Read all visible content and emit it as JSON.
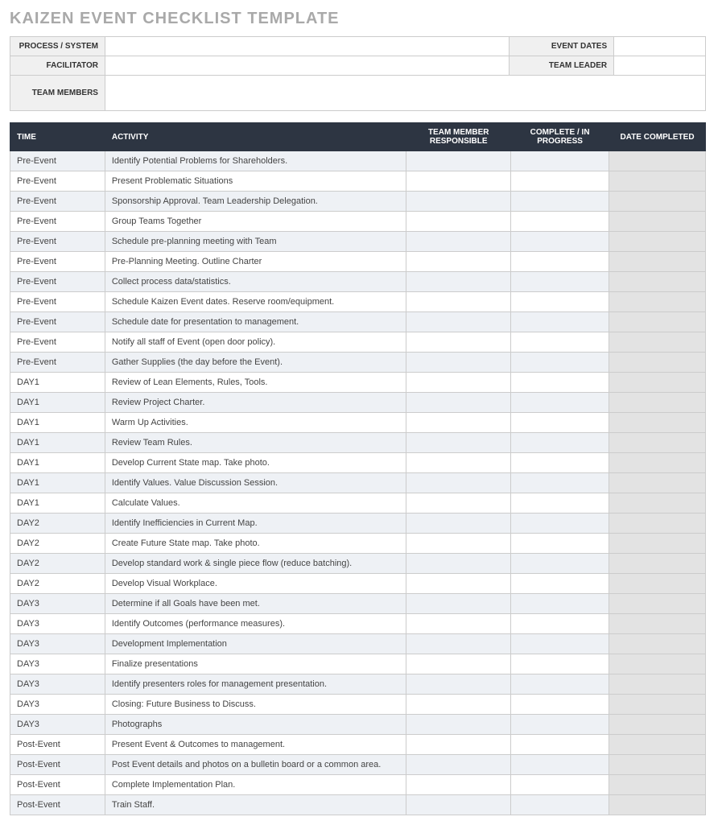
{
  "title": "KAIZEN EVENT CHECKLIST TEMPLATE",
  "info_labels": {
    "process_system": "PROCESS / SYSTEM",
    "event_dates": "EVENT DATES",
    "facilitator": "FACILITATOR",
    "team_leader": "TEAM LEADER",
    "team_members": "TEAM MEMBERS"
  },
  "info_values": {
    "process_system": "",
    "event_dates": "",
    "facilitator": "",
    "team_leader": "",
    "team_members": ""
  },
  "columns": {
    "time": "TIME",
    "activity": "ACTIVITY",
    "team_member": "TEAM MEMBER RESPONSIBLE",
    "complete": "COMPLETE / IN PROGRESS",
    "date_completed": "DATE COMPLETED"
  },
  "rows": [
    {
      "time": "Pre-Event",
      "activity": "Identify Potential Problems for Shareholders.",
      "tm": "",
      "comp": "",
      "date": ""
    },
    {
      "time": "Pre-Event",
      "activity": "Present Problematic Situations",
      "tm": "",
      "comp": "",
      "date": ""
    },
    {
      "time": "Pre-Event",
      "activity": "Sponsorship Approval. Team Leadership Delegation.",
      "tm": "",
      "comp": "",
      "date": ""
    },
    {
      "time": "Pre-Event",
      "activity": "Group Teams Together",
      "tm": "",
      "comp": "",
      "date": ""
    },
    {
      "time": "Pre-Event",
      "activity": "Schedule pre-planning meeting with Team",
      "tm": "",
      "comp": "",
      "date": ""
    },
    {
      "time": "Pre-Event",
      "activity": "Pre-Planning Meeting. Outline Charter",
      "tm": "",
      "comp": "",
      "date": ""
    },
    {
      "time": "Pre-Event",
      "activity": "Collect process data/statistics.",
      "tm": "",
      "comp": "",
      "date": ""
    },
    {
      "time": "Pre-Event",
      "activity": "Schedule Kaizen Event dates. Reserve room/equipment.",
      "tm": "",
      "comp": "",
      "date": ""
    },
    {
      "time": "Pre-Event",
      "activity": "Schedule date for presentation to management.",
      "tm": "",
      "comp": "",
      "date": ""
    },
    {
      "time": "Pre-Event",
      "activity": "Notify all staff of Event (open door policy).",
      "tm": "",
      "comp": "",
      "date": ""
    },
    {
      "time": "Pre-Event",
      "activity": "Gather Supplies (the day before the Event).",
      "tm": "",
      "comp": "",
      "date": ""
    },
    {
      "time": "DAY1",
      "activity": "Review of Lean Elements, Rules, Tools.",
      "tm": "",
      "comp": "",
      "date": ""
    },
    {
      "time": "DAY1",
      "activity": "Review Project Charter.",
      "tm": "",
      "comp": "",
      "date": ""
    },
    {
      "time": "DAY1",
      "activity": "Warm Up Activities.",
      "tm": "",
      "comp": "",
      "date": ""
    },
    {
      "time": "DAY1",
      "activity": "Review Team Rules.",
      "tm": "",
      "comp": "",
      "date": ""
    },
    {
      "time": "DAY1",
      "activity": "Develop Current State map. Take photo.",
      "tm": "",
      "comp": "",
      "date": ""
    },
    {
      "time": "DAY1",
      "activity": "Identify Values. Value Discussion Session.",
      "tm": "",
      "comp": "",
      "date": ""
    },
    {
      "time": "DAY1",
      "activity": "Calculate Values.",
      "tm": "",
      "comp": "",
      "date": ""
    },
    {
      "time": "DAY2",
      "activity": "Identify Inefficiencies in Current Map.",
      "tm": "",
      "comp": "",
      "date": ""
    },
    {
      "time": "DAY2",
      "activity": "Create Future State map. Take photo.",
      "tm": "",
      "comp": "",
      "date": ""
    },
    {
      "time": "DAY2",
      "activity": "Develop standard work & single piece flow (reduce batching).",
      "tm": "",
      "comp": "",
      "date": ""
    },
    {
      "time": "DAY2",
      "activity": "Develop Visual Workplace.",
      "tm": "",
      "comp": "",
      "date": ""
    },
    {
      "time": "DAY3",
      "activity": "Determine if all Goals have been met.",
      "tm": "",
      "comp": "",
      "date": ""
    },
    {
      "time": "DAY3",
      "activity": "Identify Outcomes (performance measures).",
      "tm": "",
      "comp": "",
      "date": ""
    },
    {
      "time": "DAY3",
      "activity": "Development Implementation",
      "tm": "",
      "comp": "",
      "date": ""
    },
    {
      "time": "DAY3",
      "activity": "Finalize presentations",
      "tm": "",
      "comp": "",
      "date": ""
    },
    {
      "time": "DAY3",
      "activity": "Identify presenters roles for management presentation.",
      "tm": "",
      "comp": "",
      "date": ""
    },
    {
      "time": "DAY3",
      "activity": "Closing: Future Business to Discuss.",
      "tm": "",
      "comp": "",
      "date": ""
    },
    {
      "time": "DAY3",
      "activity": "Photographs",
      "tm": "",
      "comp": "",
      "date": ""
    },
    {
      "time": "Post-Event",
      "activity": "Present Event & Outcomes to management.",
      "tm": "",
      "comp": "",
      "date": ""
    },
    {
      "time": "Post-Event",
      "activity": "Post Event details and photos on a bulletin board or a common area.",
      "tm": "",
      "comp": "",
      "date": ""
    },
    {
      "time": "Post-Event",
      "activity": "Complete Implementation Plan.",
      "tm": "",
      "comp": "",
      "date": ""
    },
    {
      "time": "Post-Event",
      "activity": "Train Staff.",
      "tm": "",
      "comp": "",
      "date": ""
    }
  ]
}
